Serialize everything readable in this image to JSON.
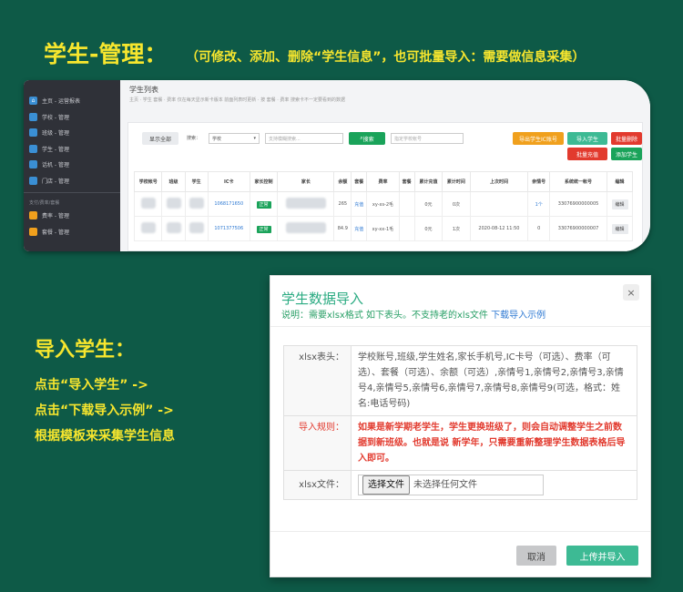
{
  "headline": {
    "title": "学生-管理：",
    "note": "（可修改、添加、删除“学生信息”，也可批量导入：需要做信息采集）"
  },
  "screenshot": {
    "sidebar": {
      "items": [
        {
          "label": "主页 - 运营报表",
          "icon": "home-icon"
        },
        {
          "label": "学校 - 管理",
          "icon": "school-icon"
        },
        {
          "label": "班级 - 管理",
          "icon": "class-icon"
        },
        {
          "label": "学生 - 管理",
          "icon": "student-icon"
        },
        {
          "label": "话机 - 管理",
          "icon": "phone-icon"
        },
        {
          "label": "门店 - 管理",
          "icon": "store-icon"
        }
      ],
      "section_label": "支付/费率/套餐",
      "section_items": [
        {
          "label": "费率 - 管理",
          "icon": "rate-icon"
        },
        {
          "label": "套餐 - 管理",
          "icon": "package-icon"
        }
      ]
    },
    "page_title": "学生列表",
    "breadcrumb": "主页 · 学生 套餐 · 费率 仅在每天显示新卡版本 前面列表时更新 · 按 套餐 · 费率 搜索卡不一定要看到的数据",
    "toolbar": {
      "show_all": "显示全部",
      "search_label": "搜索：",
      "search_scope": "学校",
      "search_placeholder": "支持模糊搜索...",
      "search_button": "搜索",
      "card_placeholder": "指定学校帐号",
      "export_ids": "导出学生IC账号",
      "import_students": "导入学生",
      "batch_delete": "批量删除",
      "batch_recharge": "批量充值",
      "add_student": "添加学生"
    },
    "table": {
      "headers": [
        "学校帐号",
        "班级",
        "学生",
        "IC卡",
        "家长控制",
        "家长",
        "余额",
        "套餐",
        "费率",
        "套餐",
        "累计充值",
        "累计时间",
        "上次时间",
        "亲情号",
        "系统统一帐号",
        "编辑"
      ],
      "rows": [
        [
          "",
          "",
          "",
          "1068171650",
          "正常",
          "",
          "265",
          "充值",
          "xy-xs-2毛",
          "",
          "0元",
          "0次",
          "",
          "1个",
          "33076900000005",
          "编辑"
        ],
        [
          "",
          "",
          "",
          "1071377506",
          "正常",
          "",
          "84.9",
          "充值",
          "xy-xx-1毛",
          "",
          "0元",
          "1次",
          "2020-08-12 11:50",
          "0",
          "33076900000007",
          "编辑"
        ]
      ]
    }
  },
  "annotation": {
    "title": "导入学生：",
    "lines": [
      "点击“导入学生” ->",
      "点击“下载导入示例” ->",
      "根据模板来采集学生信息"
    ]
  },
  "modal": {
    "title": "学生数据导入",
    "desc_text": "说明：需要xlsx格式 如下表头。不支持老的xls文件",
    "desc_link": "下载导入示例",
    "close": "×",
    "header_label": "xlsx表头：",
    "header_value": "学校账号,班级,学生姓名,家长手机号,IC卡号（可选）、费率（可选）、套餐（可选）、余额（可选）,亲情号1,亲情号2,亲情号3,亲情号4,亲情号5,亲情号6,亲情号7,亲情号8,亲情号9(可选，格式：姓名:电话号码)",
    "rule_label": "导入规则：",
    "rule_value": "如果是新学期老学生，学生更换班级了，则会自动调整学生之前数据到新班级。也就是说 新学年，只需要重新整理学生数据表格后导入即可。",
    "file_label": "xlsx文件：",
    "file_button": "选择文件",
    "file_status": "未选择任何文件",
    "cancel": "取消",
    "upload": "上传并导入"
  }
}
